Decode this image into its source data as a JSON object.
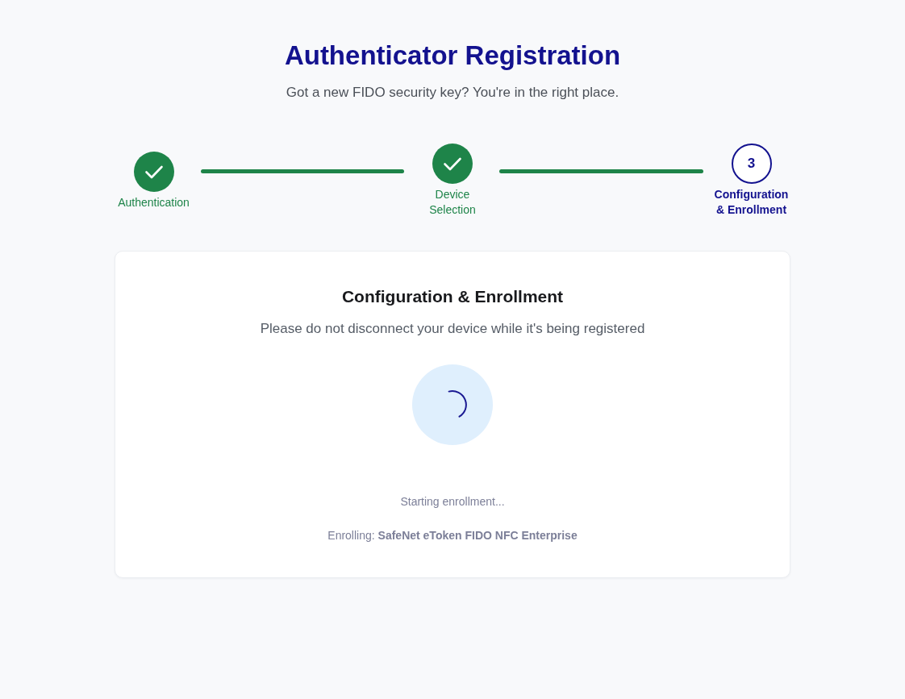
{
  "header": {
    "title": "Authenticator Registration",
    "subtitle": "Got a new FIDO security key? You're in the right place."
  },
  "steps": [
    {
      "label": "Authentication",
      "completed": true,
      "current": false
    },
    {
      "label": "Device Selection",
      "completed": true,
      "current": false
    },
    {
      "number": "3",
      "label": "Configuration & Enrollment",
      "completed": false,
      "current": true
    }
  ],
  "card": {
    "title": "Configuration & Enrollment",
    "message": "Please do not disconnect your device while it's being registered",
    "status": "Starting enrollment...",
    "device_line": "Enrolling: **SafeNet eToken FIDO NFC Enterprise**"
  }
}
